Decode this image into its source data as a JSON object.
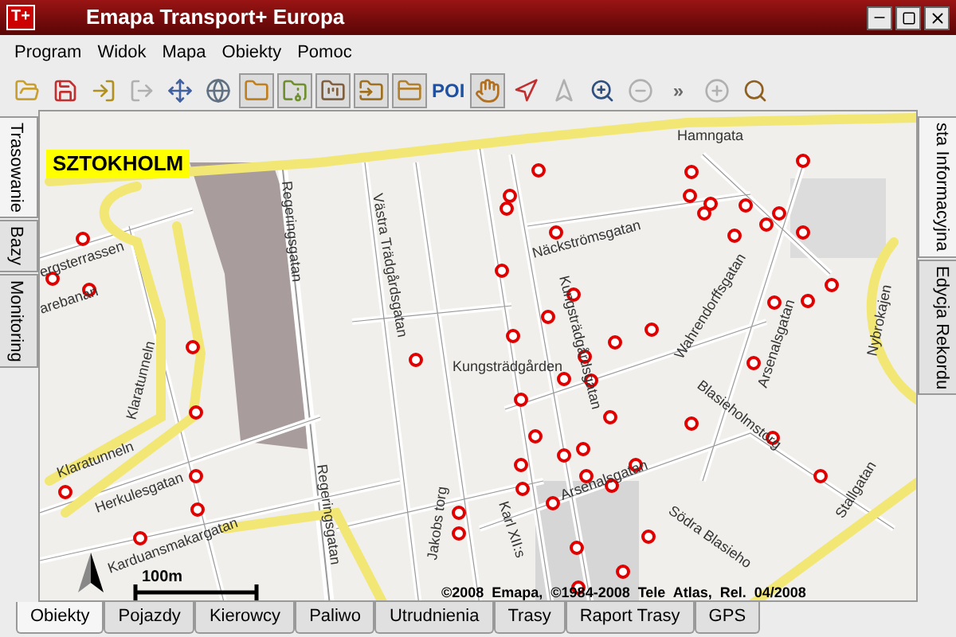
{
  "window": {
    "app_icon": "T+",
    "title": "Emapa Transport+ Europa"
  },
  "menu": [
    "Program",
    "Widok",
    "Mapa",
    "Obiekty",
    "Pomoc"
  ],
  "toolbar": [
    {
      "kind": "icon",
      "pressed": false,
      "disabled": false
    },
    {
      "kind": "icon",
      "pressed": false,
      "disabled": false
    },
    {
      "kind": "icon",
      "pressed": false,
      "disabled": false
    },
    {
      "kind": "icon",
      "pressed": false,
      "disabled": true
    },
    {
      "kind": "icon",
      "pressed": false,
      "disabled": false
    },
    {
      "kind": "icon",
      "pressed": false,
      "disabled": false
    },
    {
      "kind": "icon",
      "pressed": true,
      "disabled": false
    },
    {
      "kind": "icon",
      "pressed": true,
      "disabled": false
    },
    {
      "kind": "icon",
      "pressed": true,
      "disabled": false
    },
    {
      "kind": "icon",
      "pressed": true,
      "disabled": false
    },
    {
      "kind": "icon",
      "pressed": true,
      "disabled": false
    },
    {
      "kind": "text",
      "label": "POI",
      "pressed": false,
      "disabled": false
    },
    {
      "kind": "icon",
      "pressed": true,
      "disabled": false
    },
    {
      "kind": "icon",
      "pressed": false,
      "disabled": false
    },
    {
      "kind": "icon",
      "pressed": false,
      "disabled": true
    },
    {
      "kind": "icon",
      "pressed": false,
      "disabled": false
    },
    {
      "kind": "icon",
      "pressed": false,
      "disabled": true
    },
    {
      "kind": "text",
      "label": "»",
      "pressed": false,
      "disabled": true
    },
    {
      "kind": "icon",
      "pressed": false,
      "disabled": true
    },
    {
      "kind": "icon",
      "pressed": false,
      "disabled": false
    }
  ],
  "left_tabs": [
    {
      "label": "Trasowanie",
      "selected": true
    },
    {
      "label": "Bazy",
      "selected": false
    },
    {
      "label": "Monitoring",
      "selected": false
    }
  ],
  "right_tabs": [
    {
      "label": "sta Informacyjna",
      "selected": true
    },
    {
      "label": "Edycja Rekordu",
      "selected": false
    }
  ],
  "map": {
    "city_label": "SZTOKHOLM",
    "street_labels": [
      "Regeringsgatan",
      "Västra Trädgårdsgatan",
      "Kungsträdgården",
      "Jakobs torg",
      "Klaratunneln",
      "Klaratunneln",
      "Herkulesgatan",
      "Karduansmakargatan",
      "ergsterrassen",
      "arebanan",
      "Näckströmsgatan",
      "Kungsträdgårdsgatan",
      "Wahrendorffsgatan",
      "Arsenalsgatan",
      "Blasieholmstorg",
      "Arsenalsgatan",
      "Karl XII:s",
      "Södra Blasieho",
      "Stallgatan",
      "Nybrokajen",
      "Hamngata",
      "Regeringsgatan"
    ],
    "scale": "100m",
    "copyright": "©2008  Emapa,  ©1984-2008  Tele  Atlas,  Rel.  04/2008"
  },
  "bottom_tabs": [
    {
      "label": "Obiekty",
      "selected": true
    },
    {
      "label": "Pojazdy",
      "selected": false
    },
    {
      "label": "Kierowcy",
      "selected": false
    },
    {
      "label": "Paliwo",
      "selected": false
    },
    {
      "label": "Utrudnienia",
      "selected": false
    },
    {
      "label": "Trasy",
      "selected": false
    },
    {
      "label": "Raport Trasy",
      "selected": false
    },
    {
      "label": "GPS",
      "selected": false
    }
  ]
}
